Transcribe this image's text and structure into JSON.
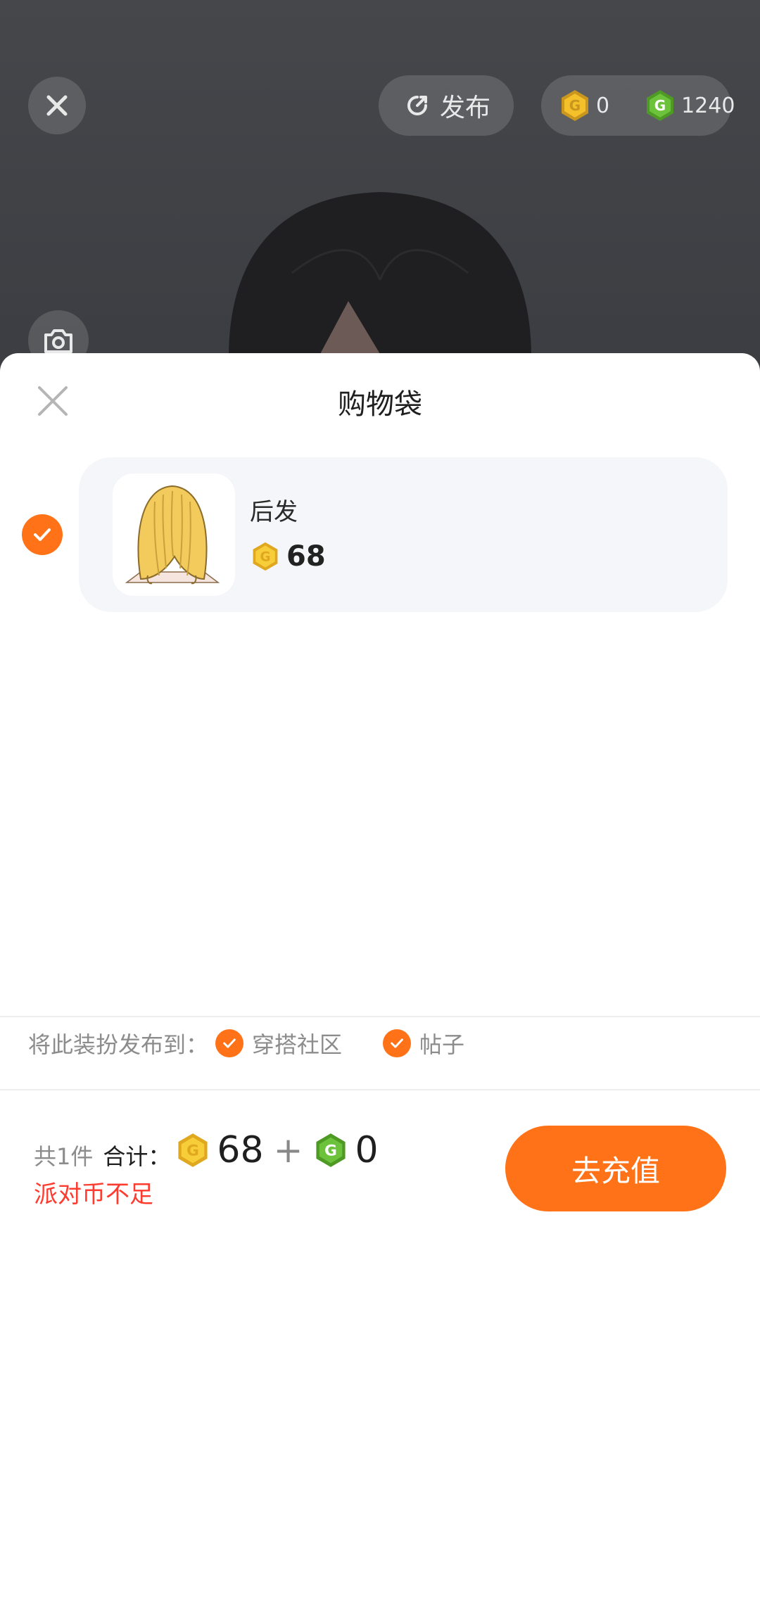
{
  "header": {
    "publish_label": "发布",
    "gold_coin_count": "0",
    "green_coin_count": "1240"
  },
  "sheet": {
    "title": "购物袋",
    "items": [
      {
        "name": "后发",
        "price": "68"
      }
    ],
    "publish_to": {
      "label": "将此装扮发布到：",
      "options": [
        "穿搭社区",
        "帖子"
      ]
    },
    "summary": {
      "count_text": "共1件",
      "total_label": "合计：",
      "gold_total": "68",
      "plus": "+",
      "green_total": "0",
      "warning": "派对币不足"
    },
    "recharge_label": "去充值"
  },
  "colors": {
    "accent": "#ff7217",
    "warning": "#ff3b2f",
    "gold": "#f5c12a",
    "green": "#6cc23a"
  }
}
